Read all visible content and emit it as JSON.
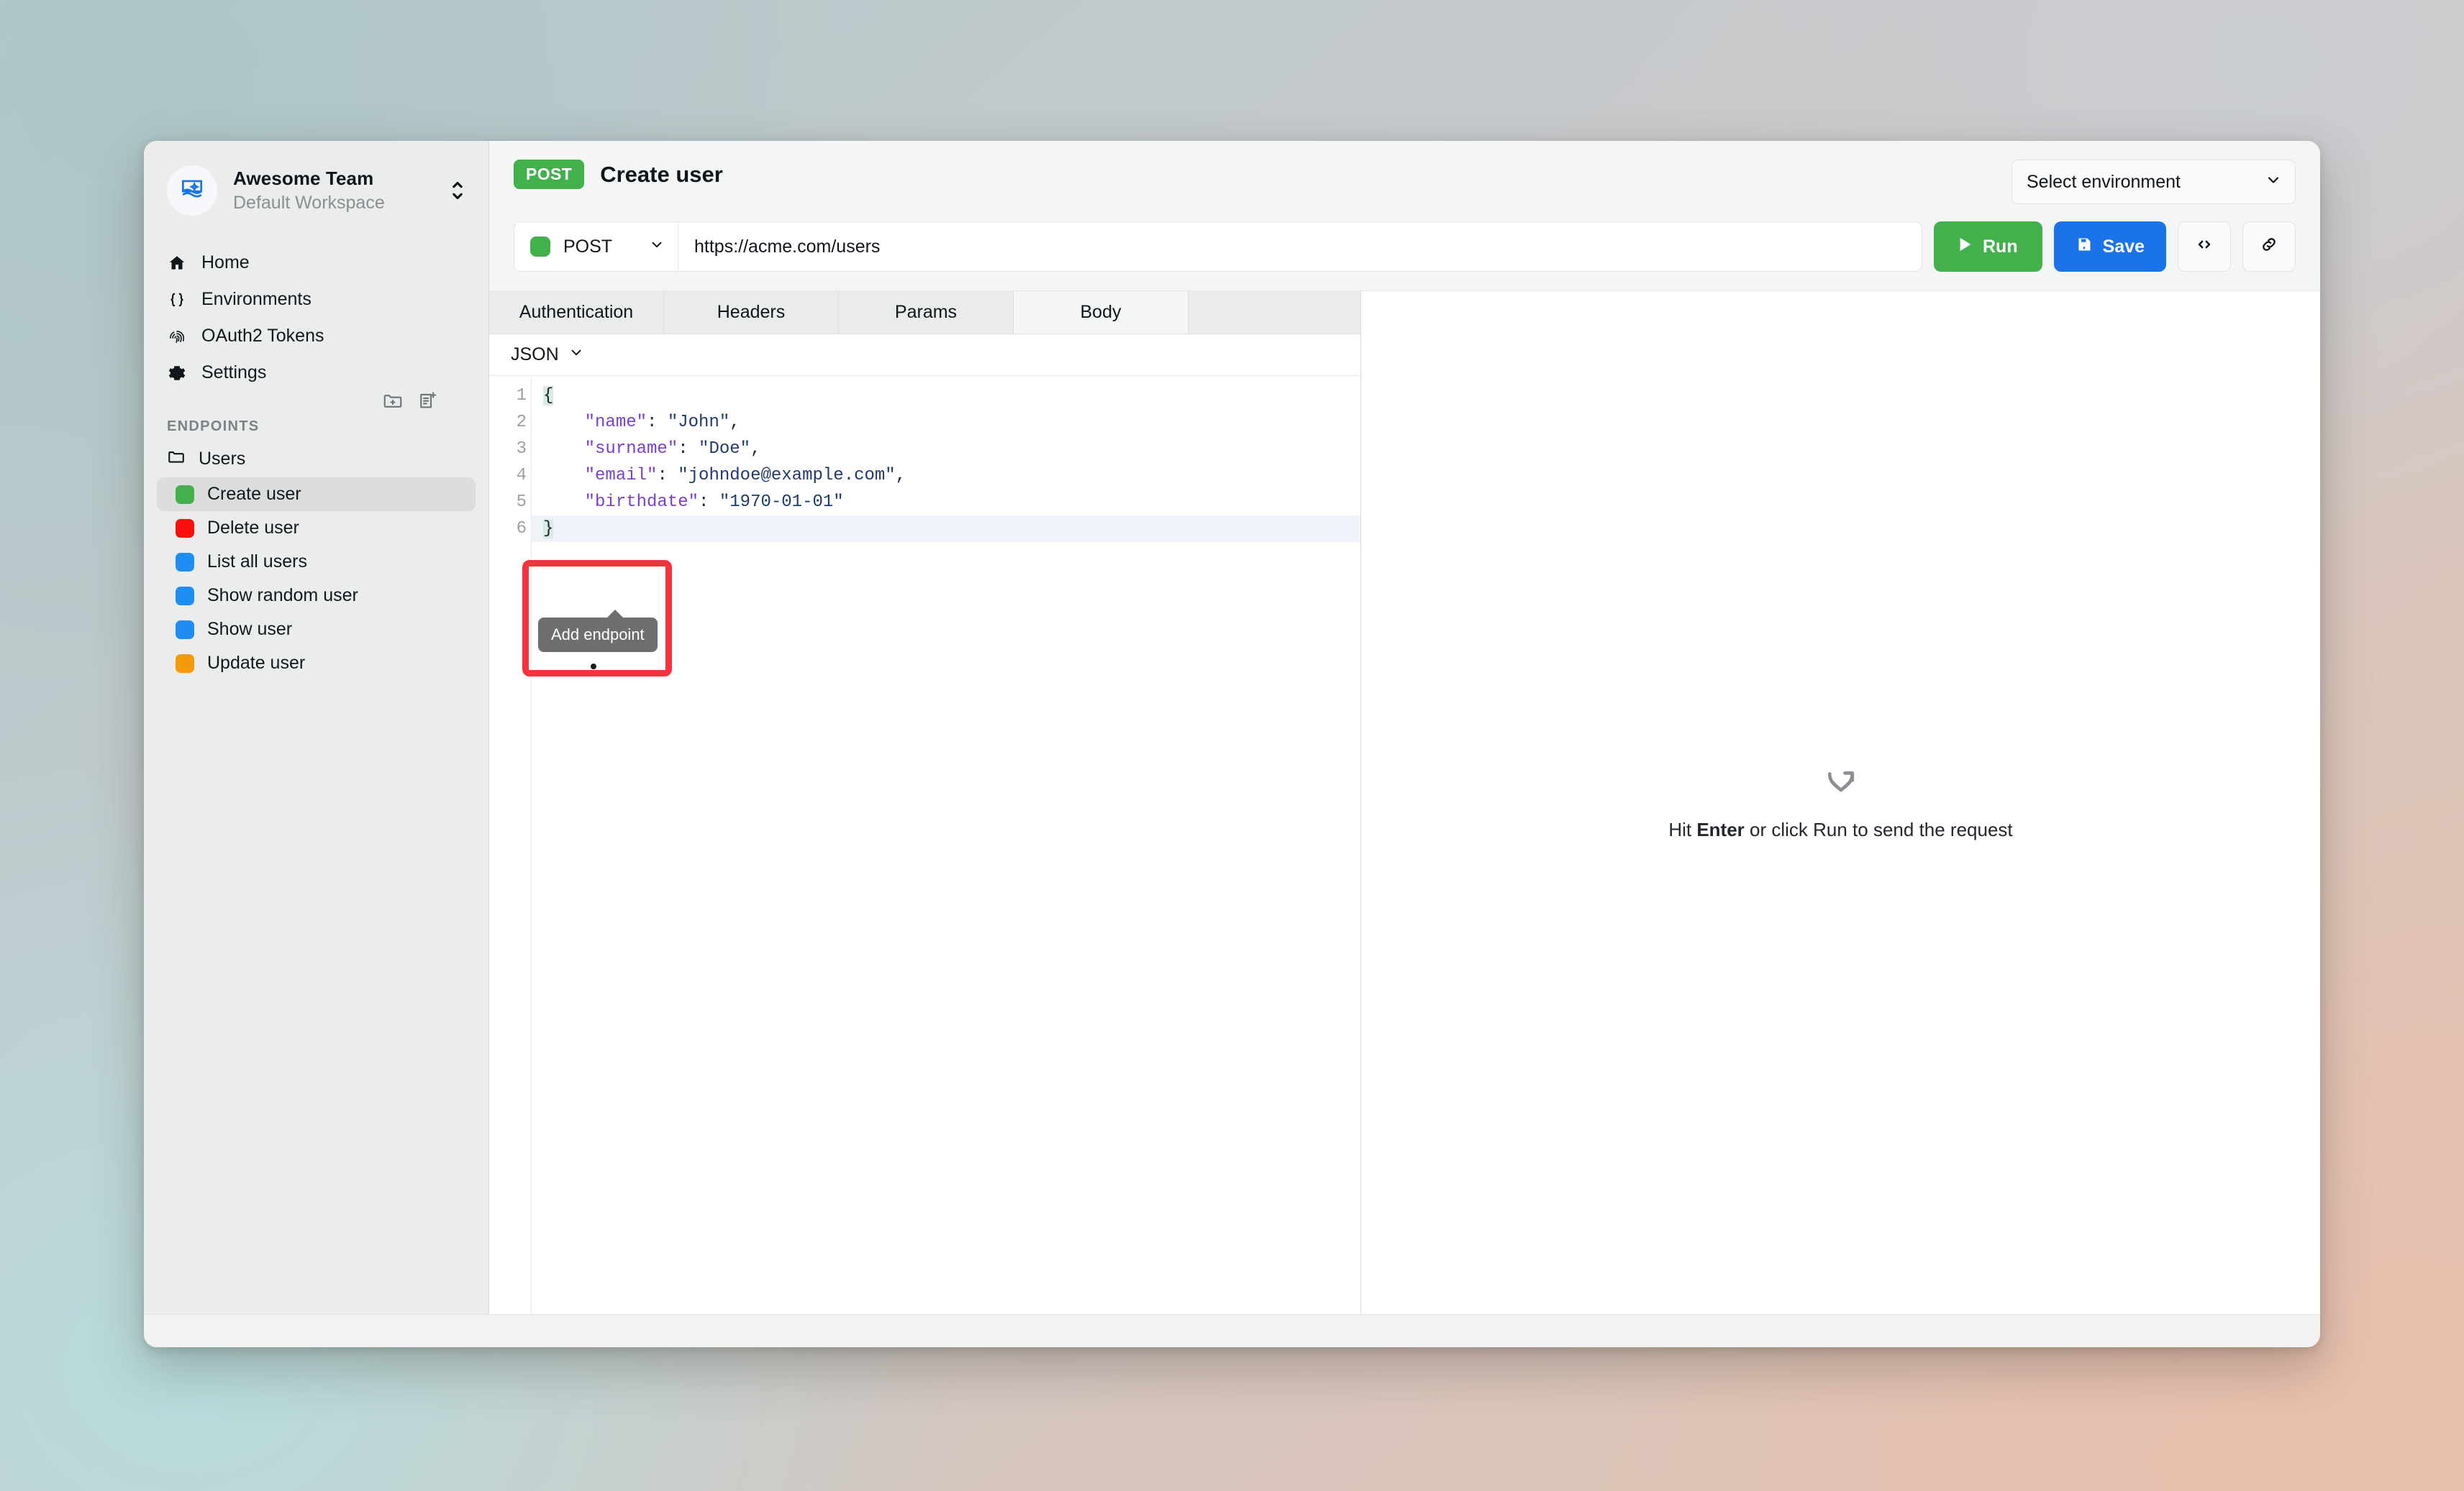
{
  "workspace": {
    "name": "Awesome Team",
    "subtitle": "Default Workspace",
    "avatar_icon": "image-sparkle-icon",
    "switcher_icon": "chevron-up-down-icon"
  },
  "sidebar": {
    "nav": [
      {
        "label": "Home",
        "icon": "home-icon"
      },
      {
        "label": "Environments",
        "icon": "braces-icon"
      },
      {
        "label": "OAuth2 Tokens",
        "icon": "fingerprint-icon"
      },
      {
        "label": "Settings",
        "icon": "gear-icon"
      }
    ],
    "section_label": "ENDPOINTS",
    "actions": [
      {
        "name": "add-folder-button",
        "icon": "folder-plus-icon"
      },
      {
        "name": "add-endpoint-button",
        "icon": "file-plus-icon"
      }
    ],
    "folder": {
      "label": "Users",
      "icon": "folder-icon"
    },
    "endpoints": [
      {
        "label": "Create user",
        "color": "#43b14b",
        "active": true
      },
      {
        "label": "Delete user",
        "color": "#fa0f0f",
        "active": false
      },
      {
        "label": "List all users",
        "color": "#1e8ef5",
        "active": false
      },
      {
        "label": "Show random user",
        "color": "#1e8ef5",
        "active": false
      },
      {
        "label": "Show user",
        "color": "#1e8ef5",
        "active": false
      },
      {
        "label": "Update user",
        "color": "#f59b0b",
        "active": false
      }
    ]
  },
  "tooltip": {
    "text": "Add endpoint"
  },
  "header": {
    "method_badge": "POST",
    "title": "Create user",
    "environment_placeholder": "Select environment"
  },
  "request": {
    "method": "POST",
    "method_color": "#43b14b",
    "url": "https://acme.com/users",
    "run_label": "Run",
    "save_label": "Save",
    "code_icon": "code-brackets-icon",
    "link_icon": "link-icon",
    "run_icon": "play-icon",
    "save_icon": "floppy-disk-icon"
  },
  "tabs": [
    {
      "label": "Authentication",
      "active": false
    },
    {
      "label": "Headers",
      "active": false
    },
    {
      "label": "Params",
      "active": false
    },
    {
      "label": "Body",
      "active": true
    }
  ],
  "body": {
    "format": "JSON",
    "line_numbers": [
      "1",
      "2",
      "3",
      "4",
      "5",
      "6"
    ],
    "lines": [
      {
        "indent": 0,
        "tokens": [
          {
            "t": "brace",
            "v": "{"
          }
        ],
        "active": false
      },
      {
        "indent": 1,
        "tokens": [
          {
            "t": "k",
            "v": "\"name\""
          },
          {
            "t": "p",
            "v": ": "
          },
          {
            "t": "s",
            "v": "\"John\""
          },
          {
            "t": "p",
            "v": ","
          }
        ],
        "active": false
      },
      {
        "indent": 1,
        "tokens": [
          {
            "t": "k",
            "v": "\"surname\""
          },
          {
            "t": "p",
            "v": ": "
          },
          {
            "t": "s",
            "v": "\"Doe\""
          },
          {
            "t": "p",
            "v": ","
          }
        ],
        "active": false
      },
      {
        "indent": 1,
        "tokens": [
          {
            "t": "k",
            "v": "\"email\""
          },
          {
            "t": "p",
            "v": ": "
          },
          {
            "t": "s",
            "v": "\"johndoe@example.com\""
          },
          {
            "t": "p",
            "v": ","
          }
        ],
        "active": false
      },
      {
        "indent": 1,
        "tokens": [
          {
            "t": "k",
            "v": "\"birthdate\""
          },
          {
            "t": "p",
            "v": ": "
          },
          {
            "t": "s",
            "v": "\"1970-01-01\""
          }
        ],
        "active": false
      },
      {
        "indent": 0,
        "tokens": [
          {
            "t": "brace",
            "v": "}"
          }
        ],
        "active": true
      }
    ]
  },
  "response": {
    "empty_icon": "arrow-branch-icon",
    "empty_prefix": "Hit ",
    "empty_key": "Enter",
    "empty_suffix": " or click Run to send the request"
  }
}
